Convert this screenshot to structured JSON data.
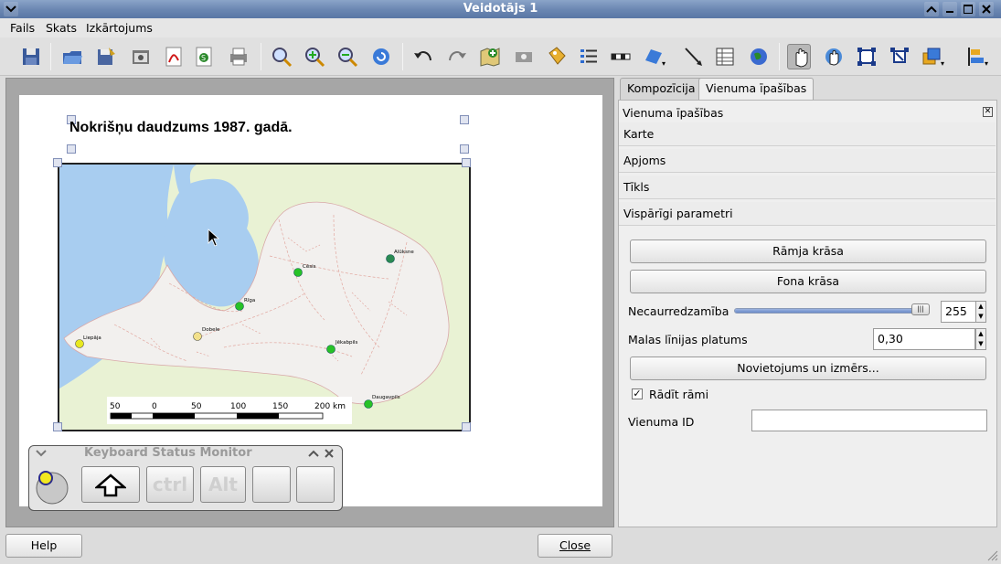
{
  "window": {
    "title": "Veidotājs 1"
  },
  "menu": {
    "items": [
      "Fails",
      "Skats",
      "Izkārtojums"
    ]
  },
  "toolbar": {
    "icons": [
      "save-icon",
      "open-template-icon",
      "save-template-icon",
      "export-image-icon",
      "export-pdf-icon",
      "export-svg-icon",
      "print-icon",
      "zoom-full-icon",
      "zoom-in-icon",
      "zoom-out-icon",
      "refresh-icon",
      "undo-icon",
      "redo-icon",
      "add-map-icon",
      "add-image-icon",
      "add-label-icon",
      "add-legend-icon",
      "add-scalebar-icon",
      "add-shape-icon",
      "add-arrow-icon",
      "add-table-icon",
      "add-html-icon",
      "select-move-icon",
      "move-content-icon",
      "group-icon",
      "ungroup-icon",
      "raise-icon",
      "align-icon"
    ]
  },
  "composition": {
    "map_title": "Nokrišņu daudzums 1987. gadā.",
    "cities": [
      "Rīga",
      "Cēsis",
      "Alūksne",
      "Liepāja",
      "Dobele",
      "Jēkabpils",
      "Daugavpils"
    ],
    "scale_labels": [
      "50",
      "0",
      "50",
      "100",
      "150",
      "200 km"
    ]
  },
  "right_panel": {
    "tabs": [
      "Kompozīcija",
      "Vienuma īpašības"
    ],
    "header": "Vienuma īpašības",
    "sections": [
      "Karte",
      "Apjoms",
      "Tīkls",
      "Vispārīgi parametri"
    ],
    "frame_color_button": "Rāmja krāsa",
    "bg_color_button": "Fona krāsa",
    "opacity_label": "Necaurredzamība",
    "opacity_value": "255",
    "opacity_level": 1.0,
    "outline_label": "Malas līnijas platums",
    "outline_value": "0,30",
    "position_button": "Novietojums un izmērs...",
    "show_frame_label": "Rādīt rāmi",
    "show_frame_checked": "✓",
    "item_id_label": "Vienuma ID",
    "item_id_value": ""
  },
  "ksm": {
    "title": "Keyboard Status Monitor",
    "keys": [
      "ctrl",
      "Alt"
    ]
  },
  "bottom": {
    "help": "Help",
    "close": "Close"
  }
}
